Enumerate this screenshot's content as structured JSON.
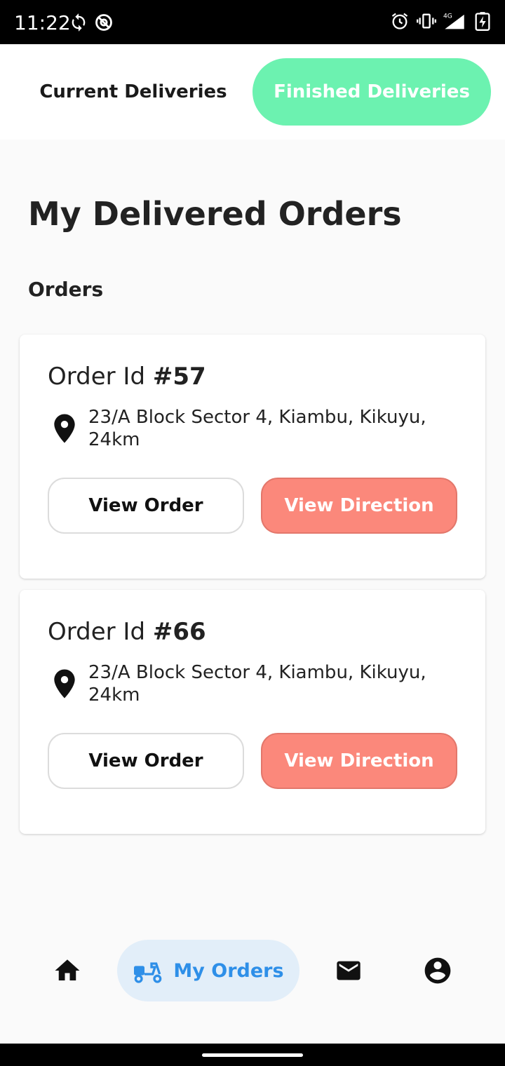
{
  "status_bar": {
    "time": "11:22",
    "left_icons": [
      "sync-icon",
      "at-sign-icon"
    ],
    "right_icons": [
      "alarm-icon",
      "vibrate-icon",
      "signal-4g-icon",
      "battery-charging-icon"
    ],
    "network_label": "4G"
  },
  "tabs": {
    "current_label": "Current Deliveries",
    "finished_label": "Finished Deliveries",
    "active": "finished",
    "active_color": "#6cf2b0"
  },
  "page": {
    "title": "My Delivered Orders",
    "section_label": "Orders"
  },
  "orders": [
    {
      "id_prefix": "Order Id ",
      "id_number": "#57",
      "address_line1": "23/A Block Sector 4, Kiambu, Kikuyu,",
      "address_line2": "24km",
      "view_order_label": "View Order",
      "view_direction_label": "View Direction"
    },
    {
      "id_prefix": "Order Id ",
      "id_number": "#66",
      "address_line1": "23/A Block Sector 4, Kiambu, Kikuyu,",
      "address_line2": "24km",
      "view_order_label": "View Order",
      "view_direction_label": "View Direction"
    }
  ],
  "bottom_nav": {
    "items": [
      {
        "icon": "home-icon"
      },
      {
        "icon": "delivery-scooter-icon",
        "label": "My Orders",
        "active": true
      },
      {
        "icon": "mail-icon"
      },
      {
        "icon": "account-circle-icon"
      }
    ],
    "active_color": "#2e8fe8"
  },
  "colors": {
    "direction_button": "#fb887b",
    "active_tab": "#6cf2b0",
    "nav_active_bg": "#e2eef9"
  }
}
